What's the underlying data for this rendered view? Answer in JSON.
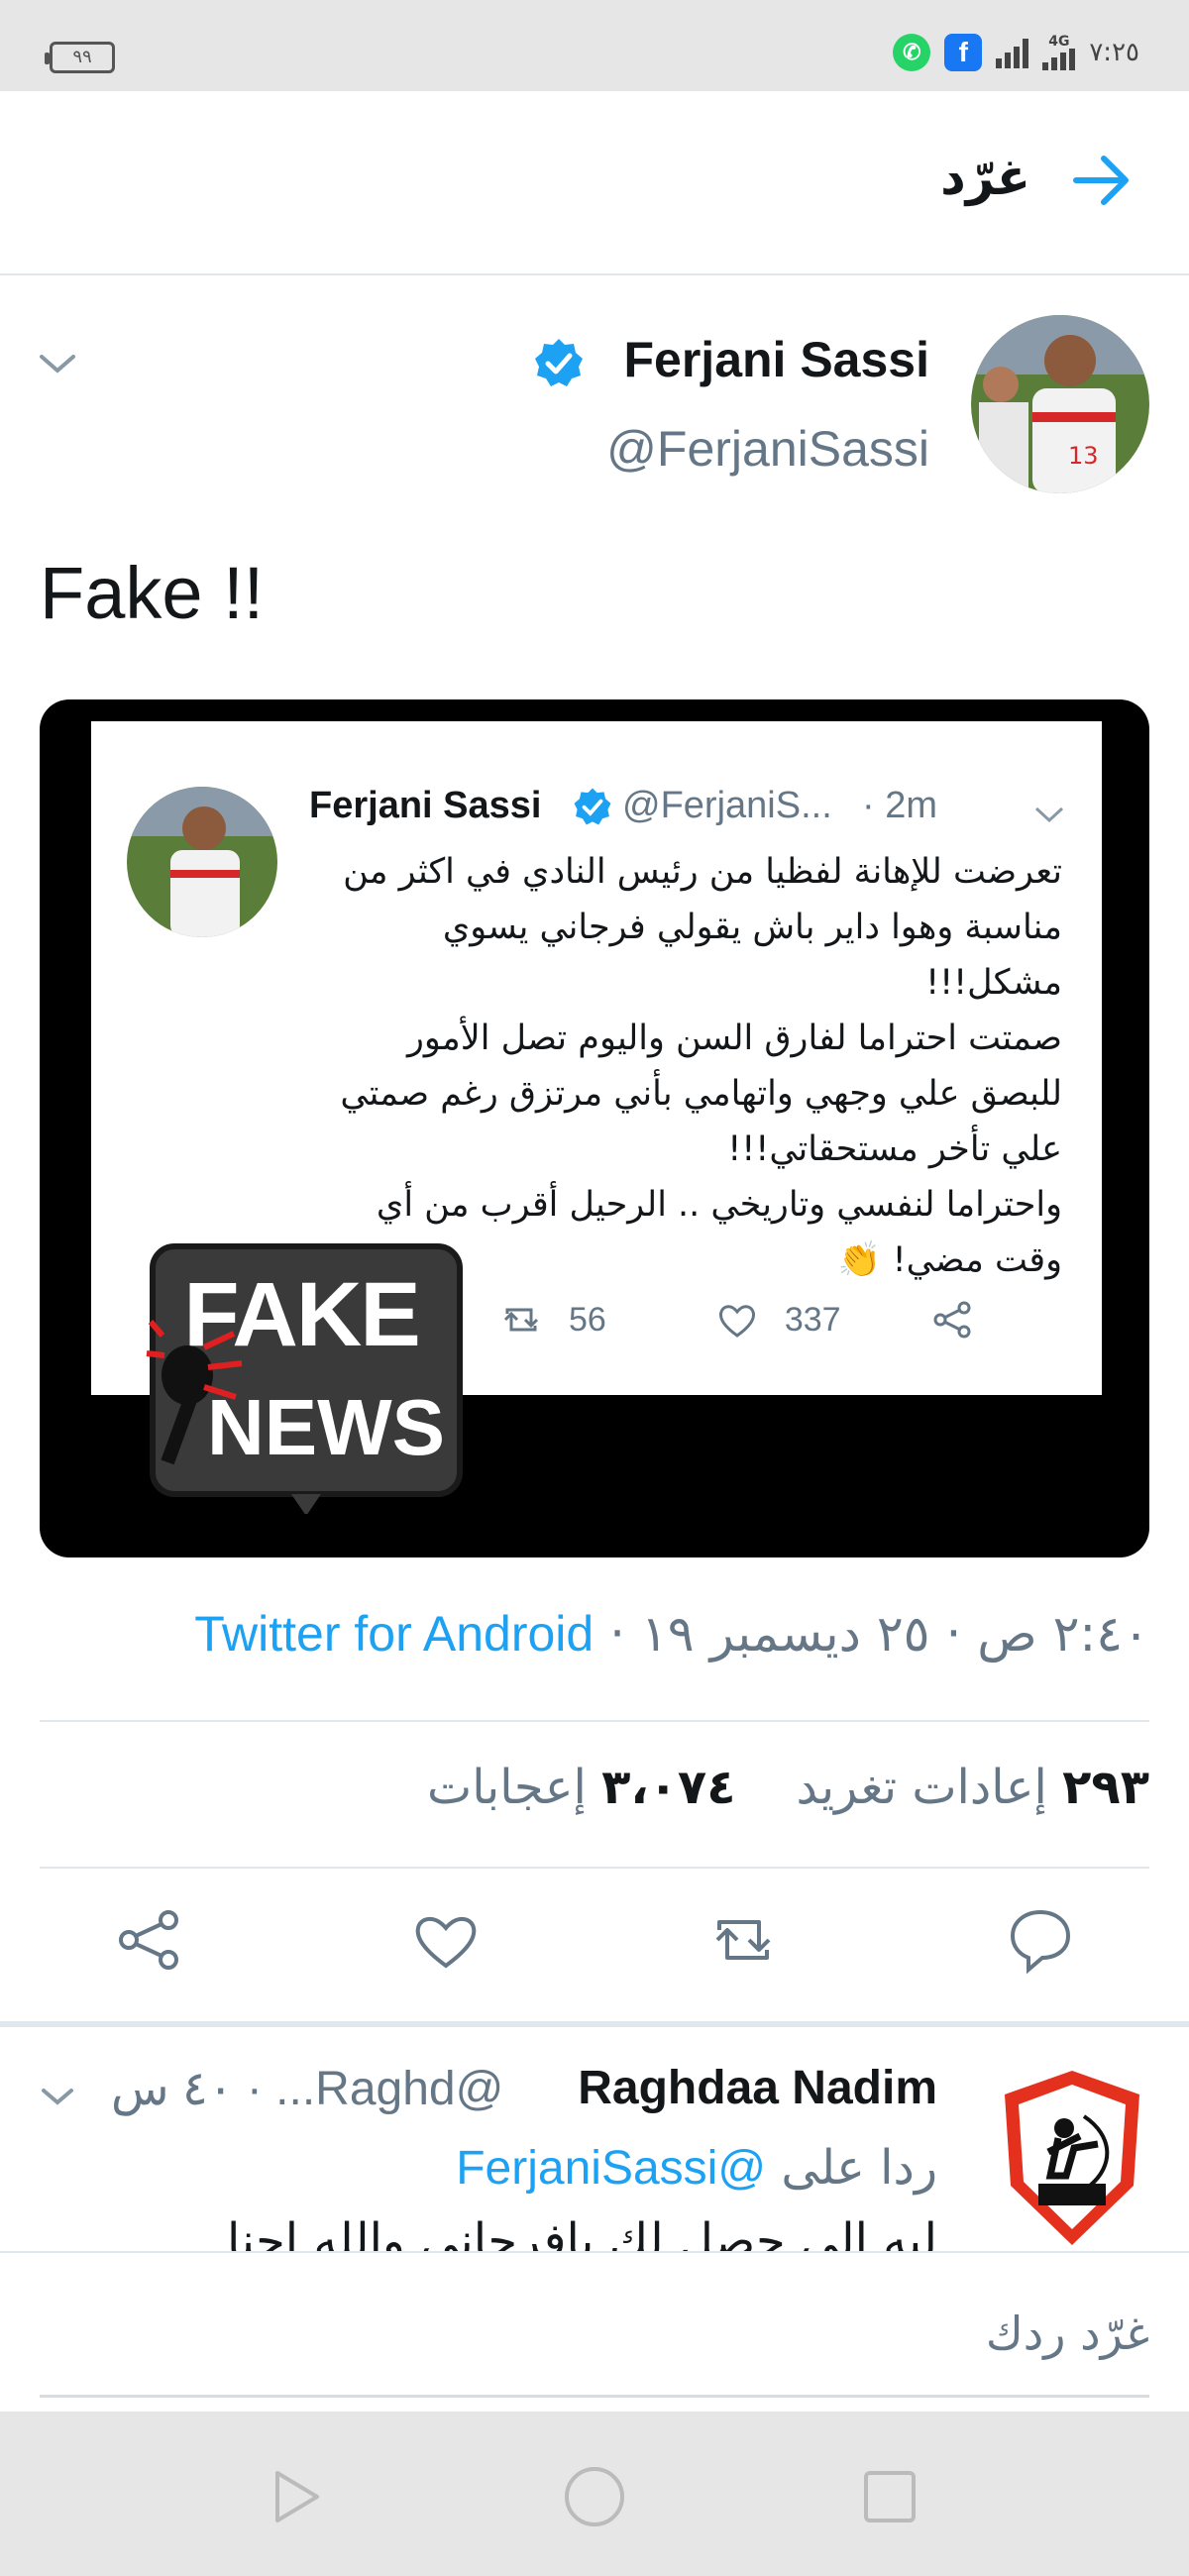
{
  "status_bar": {
    "battery": "٩٩",
    "network": "4G",
    "time": "٧:٢٥",
    "apps": [
      "whatsapp-icon",
      "facebook-icon"
    ]
  },
  "header": {
    "title": "غرّد",
    "back_icon": "arrow-icon"
  },
  "tweet": {
    "author_name": "Ferjani Sassi",
    "author_handle": "@FerjaniSassi",
    "text": "Fake !!",
    "media": {
      "embedded_tweet": {
        "name": "Ferjani Sassi",
        "handle": "@FerjaniS...",
        "time": "· 2m",
        "lines": [
          "تعرضت للإهانة لفظيا من رئيس النادي في اكثر من",
          "مناسبة وهوا داير باش يقولي فرجاني يسوي",
          "مشكل!!!",
          "صمتت احتراما لفارق السن واليوم تصل الأمور",
          "للبصق علي وجهي واتهامي بأني مرتزق رغم صمتي",
          "علي تأخر مستحقاتي!!!",
          "واحتراما لنفسي وتاريخي .. الرحيل أقرب من أي",
          "وقت مضي! 👏"
        ],
        "retweets": "56",
        "likes": "337"
      },
      "badge_line1": "FAKE",
      "badge_line2": "NEWS"
    },
    "timestamp": "٢:٤٠ ص · ٢٥ ديسمبر ١٩",
    "separator": "·",
    "via": "Twitter for Android",
    "retweets_count": "٢٩٣",
    "retweets_label": "إعادات تغريد",
    "likes_count": "٣،٠٧٤",
    "likes_label": "إعجابات"
  },
  "reply": {
    "name": "Raghdaa Nadim",
    "handle": "@Raghd... · ٤٠ س",
    "replying_to_label": "ردا على",
    "replying_to_handle": "@FerjaniSassi",
    "text": "ليه الي حصل لك يافرجاني والله احنا"
  },
  "compose": {
    "placeholder": "غرّد ردك"
  },
  "colors": {
    "accent": "#1da1f2",
    "secondary_text": "#657786",
    "divider": "#e1e8ed"
  }
}
